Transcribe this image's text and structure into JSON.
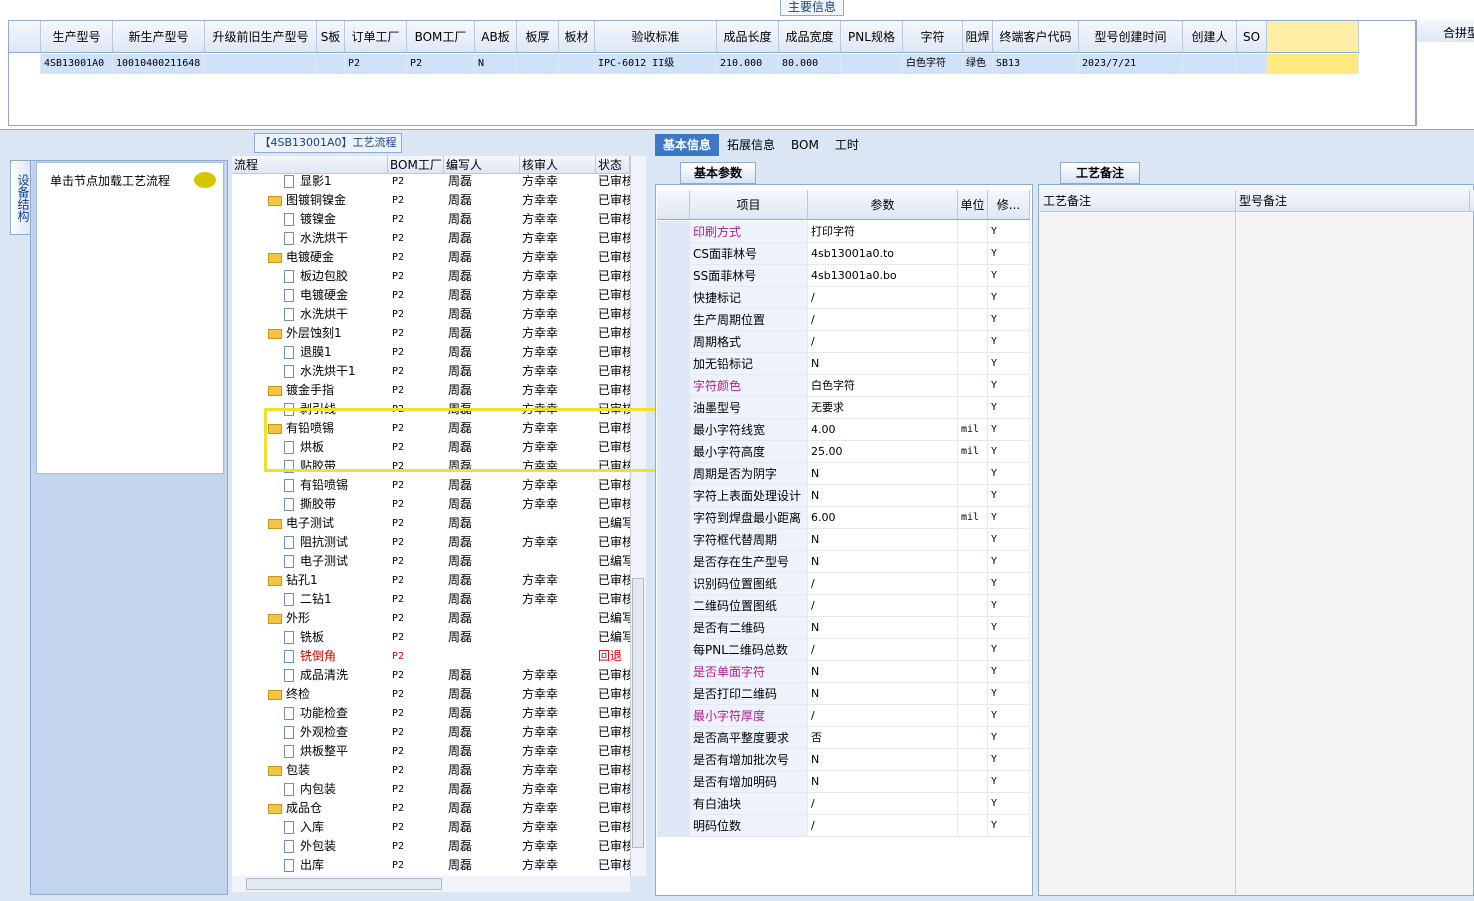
{
  "main_info_title": "主要信息",
  "top_grid": {
    "headers": [
      "生产型号",
      "新生产型号",
      "升级前旧生产型号",
      "S板",
      "订单工厂",
      "BOM工厂",
      "AB板",
      "板厚",
      "板材",
      "验收标准",
      "成品长度",
      "成品宽度",
      "PNL规格",
      "字符",
      "阻焊",
      "终端客户代码",
      "型号创建时间",
      "创建人",
      "SO"
    ],
    "row": [
      "4SB13001A0",
      "10010400211648",
      "",
      "",
      "P2",
      "P2",
      "N",
      "",
      "",
      "IPC-6012 II级",
      "210.000",
      "80.000",
      "",
      "白色字符",
      "绿色",
      "SB13",
      "2023/7/21",
      "",
      ""
    ]
  },
  "right_header": "合拼型",
  "left_pane": {
    "tab_label": "设备结构",
    "load_text": "单击节点加载工艺流程"
  },
  "tree": {
    "title": "【4SB13001A0】工艺流程",
    "headers": [
      "流程",
      "BOM工厂",
      "编写人",
      "核审人",
      "状态"
    ],
    "rows": [
      {
        "indent": 2,
        "type": "doc",
        "name": "显影1",
        "bom": "P2",
        "writer": "周磊",
        "reviewer": "方幸幸",
        "status": "已审核",
        "red": false
      },
      {
        "indent": 1,
        "type": "folder",
        "name": "图镀铜镍金",
        "bom": "P2",
        "writer": "周磊",
        "reviewer": "方幸幸",
        "status": "已审核",
        "red": false
      },
      {
        "indent": 2,
        "type": "doc",
        "name": "镀镍金",
        "bom": "P2",
        "writer": "周磊",
        "reviewer": "方幸幸",
        "status": "已审核",
        "red": false
      },
      {
        "indent": 2,
        "type": "doc",
        "name": "水洗烘干",
        "bom": "P2",
        "writer": "周磊",
        "reviewer": "方幸幸",
        "status": "已审核",
        "red": false
      },
      {
        "indent": 1,
        "type": "folder",
        "name": "电镀硬金",
        "bom": "P2",
        "writer": "周磊",
        "reviewer": "方幸幸",
        "status": "已审核",
        "red": false
      },
      {
        "indent": 2,
        "type": "doc",
        "name": "板边包胶",
        "bom": "P2",
        "writer": "周磊",
        "reviewer": "方幸幸",
        "status": "已审核",
        "red": false
      },
      {
        "indent": 2,
        "type": "doc",
        "name": "电镀硬金",
        "bom": "P2",
        "writer": "周磊",
        "reviewer": "方幸幸",
        "status": "已审核",
        "red": false
      },
      {
        "indent": 2,
        "type": "doc",
        "name": "水洗烘干",
        "bom": "P2",
        "writer": "周磊",
        "reviewer": "方幸幸",
        "status": "已审核",
        "red": false
      },
      {
        "indent": 1,
        "type": "folder",
        "name": "外层蚀刻1",
        "bom": "P2",
        "writer": "周磊",
        "reviewer": "方幸幸",
        "status": "已审核",
        "red": false
      },
      {
        "indent": 2,
        "type": "doc",
        "name": "退膜1",
        "bom": "P2",
        "writer": "周磊",
        "reviewer": "方幸幸",
        "status": "已审核",
        "red": false
      },
      {
        "indent": 2,
        "type": "doc",
        "name": "水洗烘干1",
        "bom": "P2",
        "writer": "周磊",
        "reviewer": "方幸幸",
        "status": "已审核",
        "red": false
      },
      {
        "indent": 1,
        "type": "folder",
        "name": "镀金手指",
        "bom": "P2",
        "writer": "周磊",
        "reviewer": "方幸幸",
        "status": "已审核",
        "red": false
      },
      {
        "indent": 2,
        "type": "doc",
        "name": "剥引线",
        "bom": "P2",
        "writer": "周磊",
        "reviewer": "方幸幸",
        "status": "已审核",
        "red": false
      },
      {
        "indent": 1,
        "type": "folder",
        "name": "有铅喷锡",
        "bom": "P2",
        "writer": "周磊",
        "reviewer": "方幸幸",
        "status": "已审核",
        "red": false
      },
      {
        "indent": 2,
        "type": "doc",
        "name": "烘板",
        "bom": "P2",
        "writer": "周磊",
        "reviewer": "方幸幸",
        "status": "已审核",
        "red": false
      },
      {
        "indent": 2,
        "type": "doc",
        "name": "贴胶带",
        "bom": "P2",
        "writer": "周磊",
        "reviewer": "方幸幸",
        "status": "已审核",
        "red": false
      },
      {
        "indent": 2,
        "type": "doc",
        "name": "有铅喷锡",
        "bom": "P2",
        "writer": "周磊",
        "reviewer": "方幸幸",
        "status": "已审核",
        "red": false
      },
      {
        "indent": 2,
        "type": "doc",
        "name": "撕胶带",
        "bom": "P2",
        "writer": "周磊",
        "reviewer": "方幸幸",
        "status": "已审核",
        "red": false
      },
      {
        "indent": 1,
        "type": "folder",
        "name": "电子测试",
        "bom": "P2",
        "writer": "周磊",
        "reviewer": "",
        "status": "已编写",
        "red": false
      },
      {
        "indent": 2,
        "type": "doc",
        "name": "阻抗测试",
        "bom": "P2",
        "writer": "周磊",
        "reviewer": "方幸幸",
        "status": "已审核",
        "red": false
      },
      {
        "indent": 2,
        "type": "doc",
        "name": "电子测试",
        "bom": "P2",
        "writer": "周磊",
        "reviewer": "",
        "status": "已编写",
        "red": false
      },
      {
        "indent": 1,
        "type": "folder",
        "name": "钻孔1",
        "bom": "P2",
        "writer": "周磊",
        "reviewer": "方幸幸",
        "status": "已审核",
        "red": false
      },
      {
        "indent": 2,
        "type": "doc",
        "name": "二钻1",
        "bom": "P2",
        "writer": "周磊",
        "reviewer": "方幸幸",
        "status": "已审核",
        "red": false
      },
      {
        "indent": 1,
        "type": "folder",
        "name": "外形",
        "bom": "P2",
        "writer": "周磊",
        "reviewer": "",
        "status": "已编写",
        "red": false
      },
      {
        "indent": 2,
        "type": "doc",
        "name": "铣板",
        "bom": "P2",
        "writer": "周磊",
        "reviewer": "",
        "status": "已编写",
        "red": false
      },
      {
        "indent": 2,
        "type": "doc",
        "name": "铣倒角",
        "bom": "P2",
        "writer": "",
        "reviewer": "",
        "status": "回退",
        "red": true
      },
      {
        "indent": 2,
        "type": "doc",
        "name": "成品清洗",
        "bom": "P2",
        "writer": "周磊",
        "reviewer": "方幸幸",
        "status": "已审核",
        "red": false
      },
      {
        "indent": 1,
        "type": "folder",
        "name": "终检",
        "bom": "P2",
        "writer": "周磊",
        "reviewer": "方幸幸",
        "status": "已审核",
        "red": false
      },
      {
        "indent": 2,
        "type": "doc",
        "name": "功能检查",
        "bom": "P2",
        "writer": "周磊",
        "reviewer": "方幸幸",
        "status": "已审核",
        "red": false
      },
      {
        "indent": 2,
        "type": "doc",
        "name": "外观检查",
        "bom": "P2",
        "writer": "周磊",
        "reviewer": "方幸幸",
        "status": "已审核",
        "red": false
      },
      {
        "indent": 2,
        "type": "doc",
        "name": "烘板整平",
        "bom": "P2",
        "writer": "周磊",
        "reviewer": "方幸幸",
        "status": "已审核",
        "red": false
      },
      {
        "indent": 1,
        "type": "folder",
        "name": "包装",
        "bom": "P2",
        "writer": "周磊",
        "reviewer": "方幸幸",
        "status": "已审核",
        "red": false
      },
      {
        "indent": 2,
        "type": "doc",
        "name": "内包装",
        "bom": "P2",
        "writer": "周磊",
        "reviewer": "方幸幸",
        "status": "已审核",
        "red": false
      },
      {
        "indent": 1,
        "type": "folder",
        "name": "成品仓",
        "bom": "P2",
        "writer": "周磊",
        "reviewer": "方幸幸",
        "status": "已审核",
        "red": false
      },
      {
        "indent": 2,
        "type": "doc",
        "name": "入库",
        "bom": "P2",
        "writer": "周磊",
        "reviewer": "方幸幸",
        "status": "已审核",
        "red": false
      },
      {
        "indent": 2,
        "type": "doc",
        "name": "外包装",
        "bom": "P2",
        "writer": "周磊",
        "reviewer": "方幸幸",
        "status": "已审核",
        "red": false
      },
      {
        "indent": 2,
        "type": "doc",
        "name": "出库",
        "bom": "P2",
        "writer": "周磊",
        "reviewer": "方幸幸",
        "status": "已审核",
        "red": false
      }
    ]
  },
  "tabs": [
    "基本信息",
    "拓展信息",
    "BOM",
    "工时"
  ],
  "param_tab": "基本参数",
  "param_headers": [
    "项目",
    "参数",
    "单位",
    "修..."
  ],
  "params": [
    {
      "item": "印刷方式",
      "value": "打印字符",
      "unit": "",
      "mod": "Y",
      "hl": true
    },
    {
      "item": "CS面菲林号",
      "value": "4sb13001a0.to",
      "unit": "",
      "mod": "Y",
      "hl": false
    },
    {
      "item": "SS面菲林号",
      "value": "4sb13001a0.bo",
      "unit": "",
      "mod": "Y",
      "hl": false
    },
    {
      "item": "快捷标记",
      "value": "/",
      "unit": "",
      "mod": "Y",
      "hl": false
    },
    {
      "item": "生产周期位置",
      "value": "/",
      "unit": "",
      "mod": "Y",
      "hl": false
    },
    {
      "item": "周期格式",
      "value": "/",
      "unit": "",
      "mod": "Y",
      "hl": false
    },
    {
      "item": "加无铅标记",
      "value": "N",
      "unit": "",
      "mod": "Y",
      "hl": false
    },
    {
      "item": "字符颜色",
      "value": "白色字符",
      "unit": "",
      "mod": "Y",
      "hl": true
    },
    {
      "item": "油墨型号",
      "value": "无要求",
      "unit": "",
      "mod": "Y",
      "hl": false
    },
    {
      "item": "最小字符线宽",
      "value": "4.00",
      "unit": "mil",
      "mod": "Y",
      "hl": false
    },
    {
      "item": "最小字符高度",
      "value": "25.00",
      "unit": "mil",
      "mod": "Y",
      "hl": false
    },
    {
      "item": "周期是否为阴字",
      "value": "N",
      "unit": "",
      "mod": "Y",
      "hl": false
    },
    {
      "item": "字符上表面处理设计",
      "value": "N",
      "unit": "",
      "mod": "Y",
      "hl": false
    },
    {
      "item": "字符到焊盘最小距离",
      "value": "6.00",
      "unit": "mil",
      "mod": "Y",
      "hl": false
    },
    {
      "item": "字符框代替周期",
      "value": "N",
      "unit": "",
      "mod": "Y",
      "hl": false
    },
    {
      "item": "是否存在生产型号",
      "value": "N",
      "unit": "",
      "mod": "Y",
      "hl": false
    },
    {
      "item": "识别码位置图纸",
      "value": "/",
      "unit": "",
      "mod": "Y",
      "hl": false
    },
    {
      "item": "二维码位置图纸",
      "value": "/",
      "unit": "",
      "mod": "Y",
      "hl": false
    },
    {
      "item": "是否有二维码",
      "value": "N",
      "unit": "",
      "mod": "Y",
      "hl": false
    },
    {
      "item": "每PNL二维码总数",
      "value": "/",
      "unit": "",
      "mod": "Y",
      "hl": false
    },
    {
      "item": "是否单面字符",
      "value": "N",
      "unit": "",
      "mod": "Y",
      "hl": true
    },
    {
      "item": "是否打印二维码",
      "value": "N",
      "unit": "",
      "mod": "Y",
      "hl": false
    },
    {
      "item": "最小字符厚度",
      "value": "/",
      "unit": "",
      "mod": "Y",
      "hl": true
    },
    {
      "item": "是否高平整度要求",
      "value": "否",
      "unit": "",
      "mod": "Y",
      "hl": false
    },
    {
      "item": "是否有增加批次号",
      "value": "N",
      "unit": "",
      "mod": "Y",
      "hl": false
    },
    {
      "item": "是否有增加明码",
      "value": "N",
      "unit": "",
      "mod": "Y",
      "hl": false
    },
    {
      "item": "有白油块",
      "value": "/",
      "unit": "",
      "mod": "Y",
      "hl": false
    },
    {
      "item": "明码位数",
      "value": "/",
      "unit": "",
      "mod": "Y",
      "hl": false
    }
  ],
  "remarks": {
    "tab": "工艺备注",
    "col1": "工艺备注",
    "col2": "型号备注"
  }
}
